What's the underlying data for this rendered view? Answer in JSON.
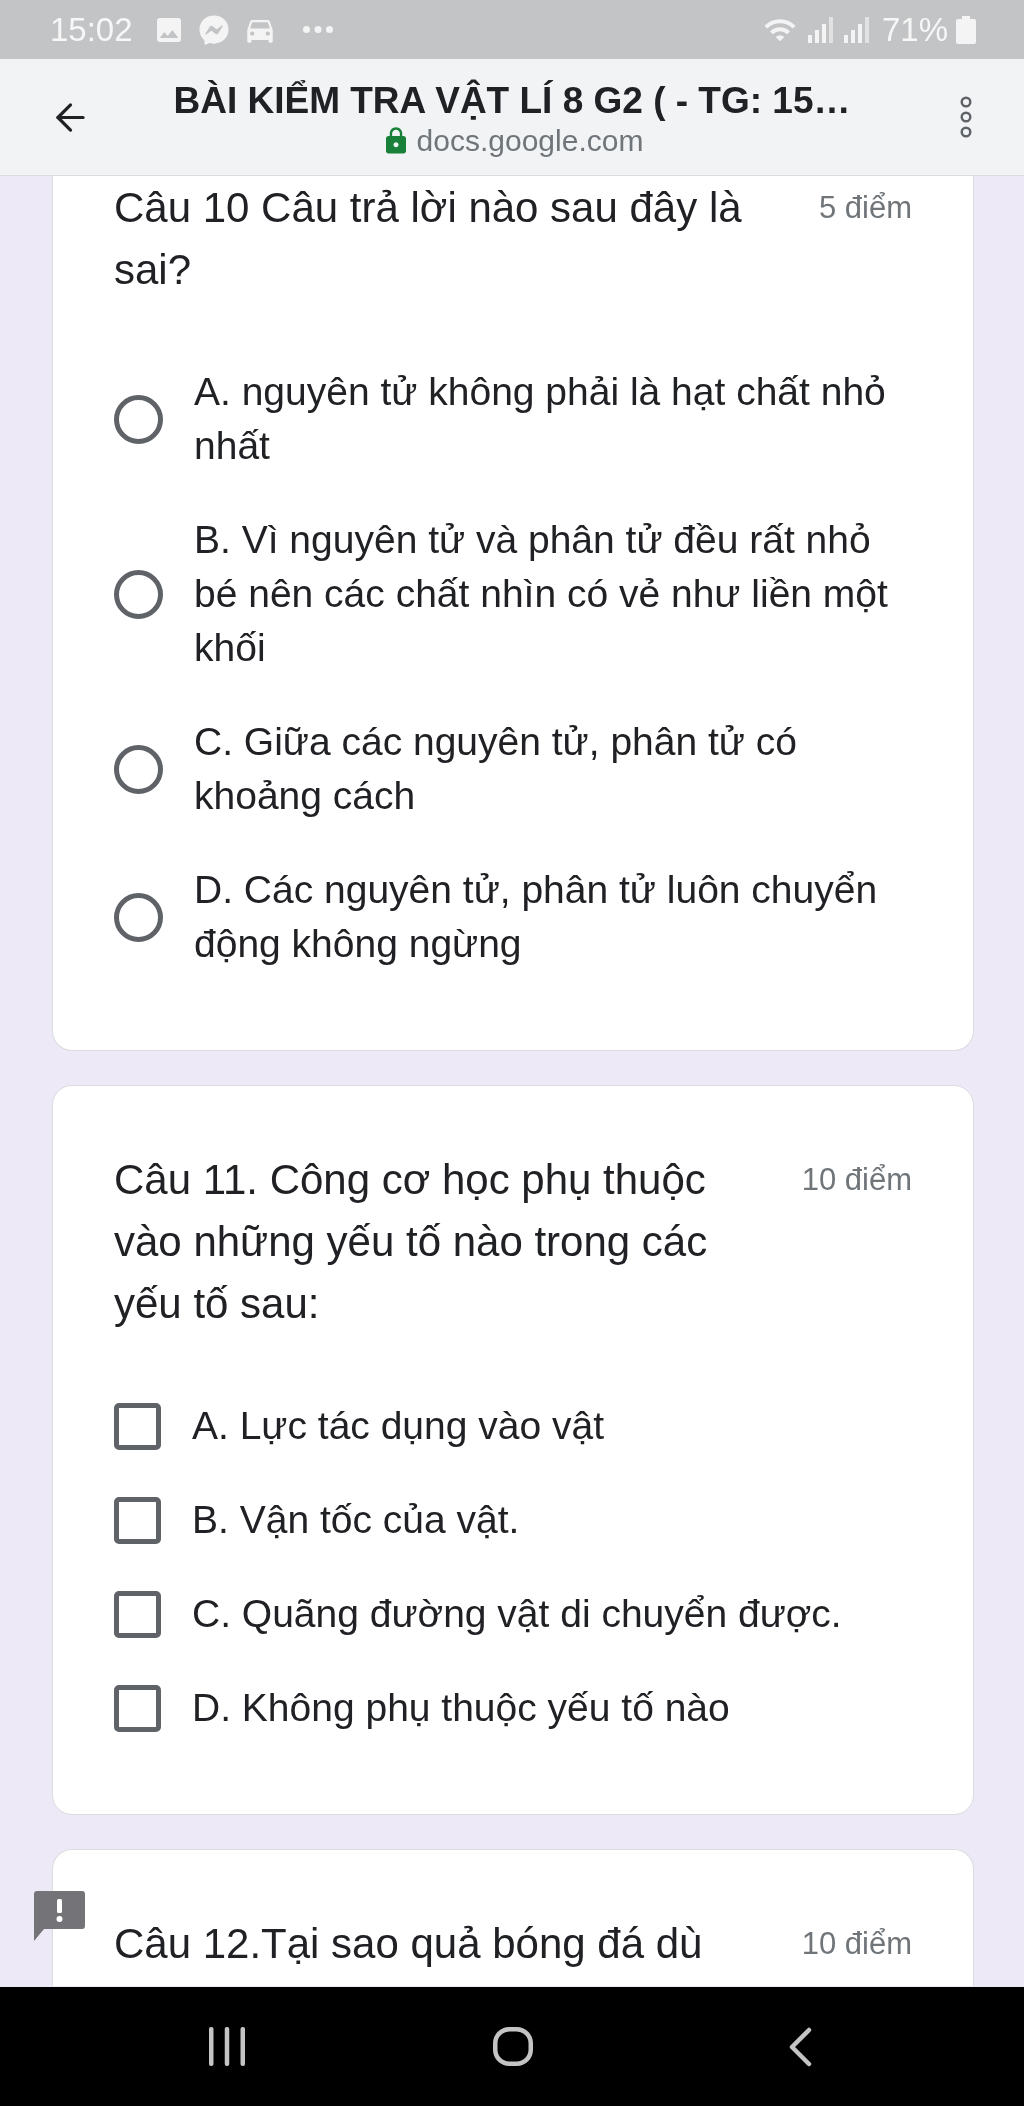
{
  "status_bar": {
    "time": "15:02",
    "battery": "71%"
  },
  "browser_bar": {
    "title": "BÀI KIỂM TRA VẬT LÍ 8 G2 ( - TG: 15…",
    "url": "docs.google.com"
  },
  "questions": [
    {
      "kind": "radio",
      "title": "Câu 10 Câu trả lời nào sau đây là sai?",
      "points": "5 điểm",
      "options": [
        {
          "label": "A. nguyên tử không phải là hạt chất nhỏ nhất",
          "selected": false
        },
        {
          "label": "B. Vì nguyên tử và phân tử đều rất nhỏ bé nên các chất nhìn có vẻ như liền một khối",
          "selected": false
        },
        {
          "label": "C. Giữa các nguyên tử, phân tử có khoảng cách",
          "selected": false
        },
        {
          "label": "D. Các nguyên tử, phân tử luôn chuyển động không ngừng",
          "selected": false
        }
      ]
    },
    {
      "kind": "checkbox",
      "title": "Câu 11. Công cơ học phụ thuộc vào những yếu tố nào trong các yếu tố sau:",
      "points": "10 điểm",
      "options": [
        {
          "label": "A. Lực tác dụng vào vật",
          "checked": false
        },
        {
          "label": "B. Vận tốc của vật.",
          "checked": false
        },
        {
          "label": "C. Quãng đường vật di chuyển được.",
          "checked": false
        },
        {
          "label": "D. Không phụ thuộc yếu tố nào",
          "checked": false
        }
      ]
    },
    {
      "title": "Câu 12.Tại sao quả bóng đá dù",
      "points": "10 điểm"
    }
  ]
}
